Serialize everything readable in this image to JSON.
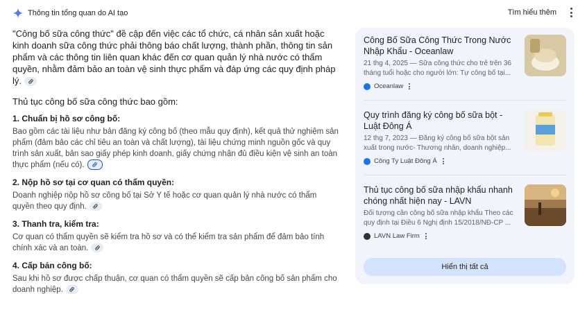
{
  "header": {
    "title": "Thông tin tổng quan do AI tạo",
    "learn_more": "Tìm hiểu thêm",
    "icon": "gemini-sparkle-icon"
  },
  "content": {
    "intro": "\"Công bố sữa công thức\" đề cập đến việc các tổ chức, cá nhân sản xuất hoặc kinh doanh sữa công thức phải thông báo chất lượng, thành phần, thông tin sản phẩm và các thông tin liên quan khác đến cơ quan quản lý nhà nước có thẩm quyền, nhằm đảm bảo an toàn vệ sinh thực phẩm và đáp ứng các quy định pháp lý.",
    "subhead": "Thủ tục công bố sữa công thức bao gồm:",
    "steps": [
      {
        "title": "1. Chuẩn bị hồ sơ công bố:",
        "desc": "Bao gồm các tài liệu như bản đăng ký công bố (theo mẫu quy định), kết quả thử nghiệm sản phẩm (đảm bảo các chỉ tiêu an toàn và chất lượng), tài liệu chứng minh nguồn gốc và quy trình sản xuất, bản sao giấy phép kinh doanh, giấy chứng nhận đủ điều kiện vệ sinh an toàn thực phẩm (nếu có)."
      },
      {
        "title": "2. Nộp hồ sơ tại cơ quan có thẩm quyền:",
        "desc": "Doanh nghiệp nộp hồ sơ công bố tại Sở Y tế hoặc cơ quan quản lý nhà nước có thẩm quyền theo quy định."
      },
      {
        "title": "3. Thanh tra, kiểm tra:",
        "desc": "Cơ quan có thẩm quyền sẽ kiểm tra hồ sơ và có thể kiểm tra sản phẩm để đảm bảo tính chính xác và an toàn."
      },
      {
        "title": "4. Cấp bản công bố:",
        "desc": "Sau khi hồ sơ được chấp thuận, cơ quan có thẩm quyền sẽ cấp bản công bố sản phẩm cho doanh nghiệp."
      }
    ]
  },
  "sources": [
    {
      "title": "Công Bố Sữa Công Thức Trong Nước Nhập Khẩu - Oceanlaw",
      "snippet": "21 thg 4, 2025 — Sữa công thức cho trẻ trên 36 tháng tuổi hoặc cho người lớn: Tự công bố tại...",
      "source": "Oceanlaw",
      "favicon_color": "#1a73e8",
      "thumb_color": "#c9b58a"
    },
    {
      "title": "Quy trình đăng ký công bố sữa bột - Luật Đông Á",
      "snippet": "12 thg 7, 2023 — Đăng ký công bố sữa bột sản xuất trong nước- Thương nhân, doanh nghiệp...",
      "source": "Công Ty Luật Đông Á",
      "favicon_color": "#1a73e8",
      "thumb_color": "#e8d9a0"
    },
    {
      "title": "Thủ tục công bố sữa nhập khẩu nhanh chóng nhất hiện nay - LAVN",
      "snippet": "Đối tượng cần công bố sữa nhập khẩu Theo các quy định tại Điều 6 Nghị định 15/2018/NĐ-CP ...",
      "source": "LAVN Law Firm",
      "favicon_color": "#333333",
      "thumb_color": "#7a5b3a"
    }
  ],
  "show_all": "Hiển thị tất cả"
}
